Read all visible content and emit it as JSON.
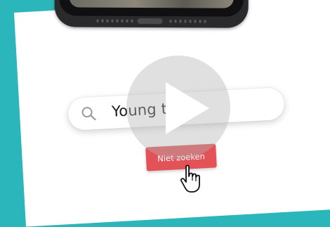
{
  "search": {
    "query": "Young teens",
    "icon": "search-icon"
  },
  "button": {
    "label": "Niet zoeken",
    "color": "#e25257"
  },
  "cursor": {
    "icon": "hand-pointer-icon"
  },
  "video": {
    "icon": "play-icon"
  },
  "colors": {
    "background": "#2bb6bb",
    "card": "#ffffff"
  }
}
